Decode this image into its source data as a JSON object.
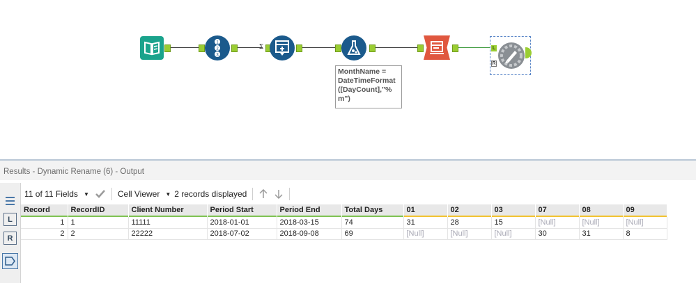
{
  "workflow": {
    "annotation": [
      "MonthName =",
      "DateTimeFormat",
      "([DayCount],\"%",
      "m\")"
    ],
    "sum_glyph": "Σ",
    "anchor_labels": {
      "left": "L",
      "right": "R"
    }
  },
  "results": {
    "title": "Results - Dynamic Rename (6) - Output",
    "fields_label": "11 of 11 Fields",
    "viewer_label": "Cell Viewer",
    "records_label": "2 records displayed",
    "sidebar": {
      "l_label": "L",
      "r_label": "R"
    },
    "columns": [
      "Record",
      "RecordID",
      "Client Number",
      "Period Start",
      "Period End",
      "Total Days",
      "01",
      "02",
      "03",
      "07",
      "08",
      "09"
    ],
    "rows": [
      [
        "1",
        "1",
        "11111",
        "2018-01-01",
        "2018-03-15",
        "74",
        "31",
        "28",
        "15",
        "[Null]",
        "[Null]",
        "[Null]"
      ],
      [
        "2",
        "2",
        "22222",
        "2018-07-02",
        "2018-09-08",
        "69",
        "[Null]",
        "[Null]",
        "[Null]",
        "30",
        "31",
        "8"
      ]
    ]
  },
  "colors": {
    "input_tool": "#1aa38c",
    "blue_tool": "#1b5a8c",
    "render_tool": "#e0573f",
    "anchor": "#9acd32",
    "accent_bar_green": "#7ec252",
    "accent_bar_yellow": "#f2c230"
  }
}
